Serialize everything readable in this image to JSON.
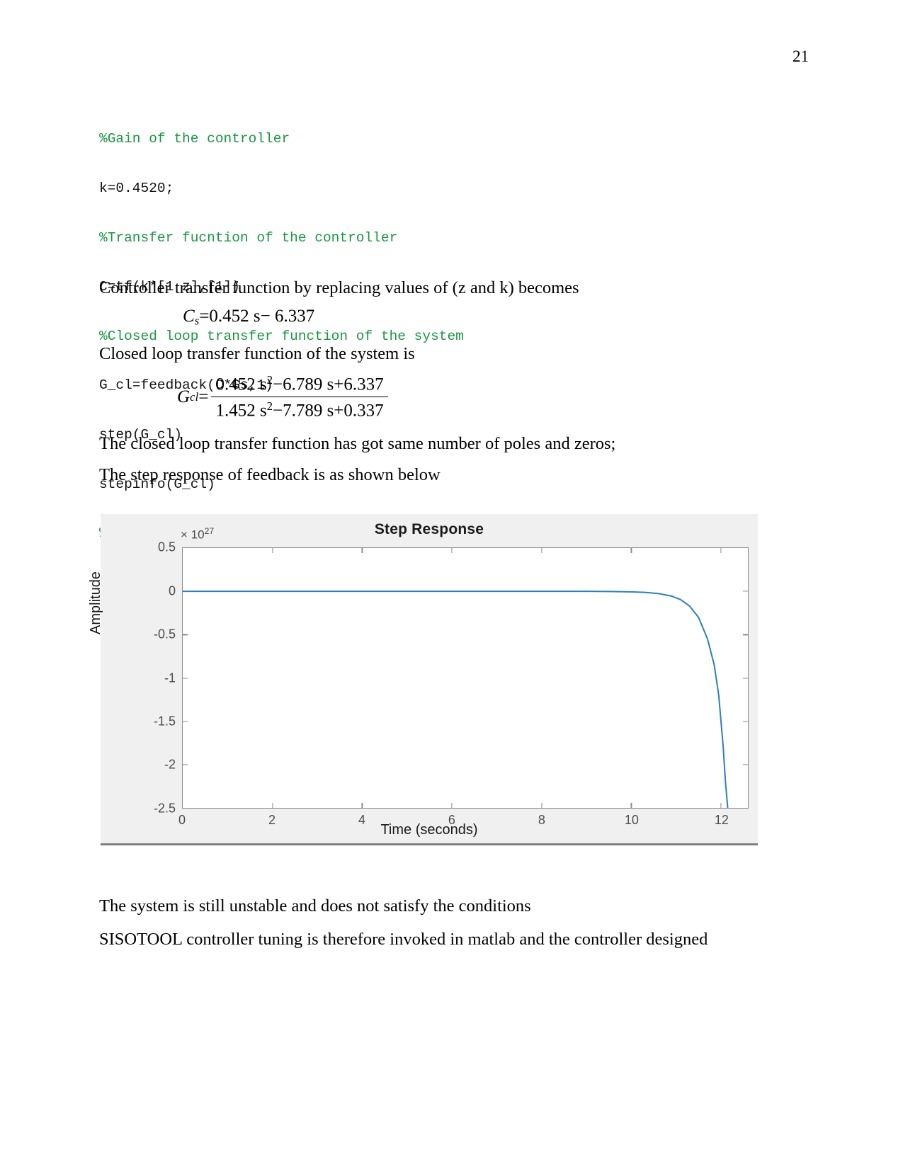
{
  "page": {
    "number": "21"
  },
  "code_block": {
    "lines": [
      {
        "text": "%Gain of the controller",
        "kind": "comment"
      },
      {
        "text": "k=0.4520;",
        "kind": "code"
      },
      {
        "text": "%Transfer fucntion of the controller",
        "kind": "comment"
      },
      {
        "text": "C=tf(k*[1 z],[1])",
        "kind": "code"
      },
      {
        "text": "%Closed loop transfer function of the system",
        "kind": "comment"
      },
      {
        "text": "G_cl=feedback(C*Gs,1)",
        "kind": "code"
      },
      {
        "text": "step(G_cl)",
        "kind": "code"
      },
      {
        "text": "stepinfo(G_cl)",
        "kind": "code"
      },
      {
        "text": "%-------------------------------------------------------------",
        "kind": "dash"
      }
    ],
    "comment_color": "#1a9641",
    "code_color": "#111111"
  },
  "paragraphs": {
    "p1": "Controller transfer function by replacing values of (z and k) becomes",
    "p2": "Closed loop transfer function of the system is",
    "p3": "The closed loop transfer function has got same number of poles and zeros;",
    "p4": "The step response of feedback is as shown below",
    "p5": "The system is still unstable and does not satisfy the conditions",
    "p6": "SISOTOOL controller tuning is therefore invoked in matlab and the controller designed"
  },
  "equations": {
    "eq1": {
      "lhs_var": "C",
      "lhs_sub": "s",
      "equals": "=",
      "rhs": "0.452 s− 6.337"
    },
    "eq2": {
      "lhs_var": "G",
      "lhs_sub": "cl",
      "equals": "=",
      "numerator_a": "0.452 s",
      "numerator_sup": "2",
      "numerator_b": "−6.789 s+6.337",
      "denominator_a": "1.452 s",
      "denominator_sup": "2",
      "denominator_b": "−7.789 s+0.337"
    }
  },
  "chart_data": {
    "type": "line",
    "title": "Step Response",
    "xlabel": "Time (seconds)",
    "ylabel": "Amplitude",
    "exponent_prefix": "× 10",
    "exponent_power": "27",
    "xlim": [
      0,
      12.6
    ],
    "ylim": [
      -2.5,
      0.5
    ],
    "xticks": [
      "0",
      "2",
      "4",
      "6",
      "8",
      "10",
      "12"
    ],
    "xtick_values": [
      0,
      2,
      4,
      6,
      8,
      10,
      12
    ],
    "yticks": [
      "0.5",
      "0",
      "-0.5",
      "-1",
      "-1.5",
      "-2",
      "-2.5"
    ],
    "ytick_values": [
      0.5,
      0,
      -0.5,
      -1,
      -1.5,
      -2,
      -2.5
    ],
    "grid": false,
    "legend": null,
    "line_color": "#2e7ebb",
    "background": "#f0f0f0",
    "plot_background": "#ffffff",
    "series": [
      {
        "name": "Step response",
        "x": [
          0,
          1,
          2,
          3,
          4,
          5,
          6,
          7,
          8,
          9,
          9.5,
          10,
          10.3,
          10.6,
          10.9,
          11.1,
          11.3,
          11.5,
          11.7,
          11.85,
          11.95,
          12.05,
          12.1,
          12.15
        ],
        "y": [
          0,
          0,
          0,
          0,
          0,
          0,
          0,
          0,
          0,
          0,
          -0.002,
          -0.006,
          -0.012,
          -0.025,
          -0.055,
          -0.095,
          -0.17,
          -0.3,
          -0.55,
          -0.85,
          -1.2,
          -1.8,
          -2.2,
          -2.5
        ]
      }
    ]
  }
}
